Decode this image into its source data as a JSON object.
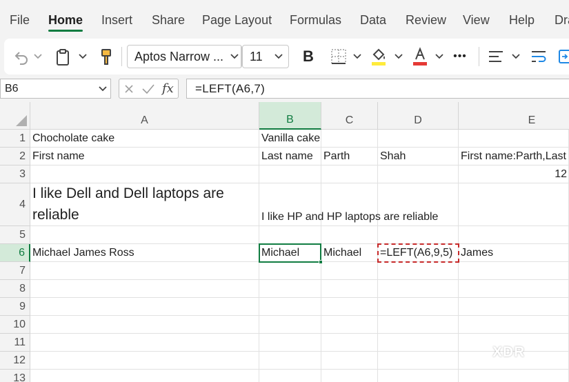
{
  "ribbon": {
    "tabs": [
      {
        "label": "File"
      },
      {
        "label": "Home",
        "active": true
      },
      {
        "label": "Insert"
      },
      {
        "label": "Share"
      },
      {
        "label": "Page Layout"
      },
      {
        "label": "Formulas"
      },
      {
        "label": "Data"
      },
      {
        "label": "Review"
      },
      {
        "label": "View"
      },
      {
        "label": "Help"
      },
      {
        "label": "Dra"
      }
    ],
    "accent": "#107c41"
  },
  "toolbar": {
    "font_name": "Aptos Narrow ...",
    "font_size": "11",
    "bold_label": "B",
    "more_label": "•••",
    "icons": [
      "undo-icon",
      "paste-icon",
      "format-painter-icon",
      "bold-icon",
      "borders-icon",
      "fill-color-icon",
      "font-color-icon",
      "more-icon",
      "align-icon",
      "wrap-text-icon",
      "merge-icon"
    ],
    "fill_color": "#ffeb3b",
    "font_color": "#e53935"
  },
  "formula_bar": {
    "name_box": "B6",
    "fx_label": "fx",
    "formula": "=LEFT(A6,7)"
  },
  "grid": {
    "columns": [
      "A",
      "B",
      "C",
      "D",
      "E"
    ],
    "selected_column": "B",
    "rows": [
      "1",
      "2",
      "3",
      "4",
      "5",
      "6",
      "7",
      "8",
      "9",
      "10",
      "11",
      "12",
      "13"
    ],
    "selected_row": "6",
    "cells": {
      "A1": "Chocholate cake",
      "B1": "Vanilla cake",
      "A2": "First name",
      "B2": "Last name",
      "C2": "Parth",
      "D2": "Shah",
      "E2": "First name:Parth,Last",
      "E3": "12",
      "A4": "I like Dell and Dell laptops are reliable",
      "B4": "I like HP and HP laptops are reliable",
      "A6": "Michael James Ross",
      "B6": "Michael",
      "C6": "Michael",
      "D6": "=LEFT(A6,9,5)",
      "E6": "James"
    }
  },
  "watermark": "XDR"
}
